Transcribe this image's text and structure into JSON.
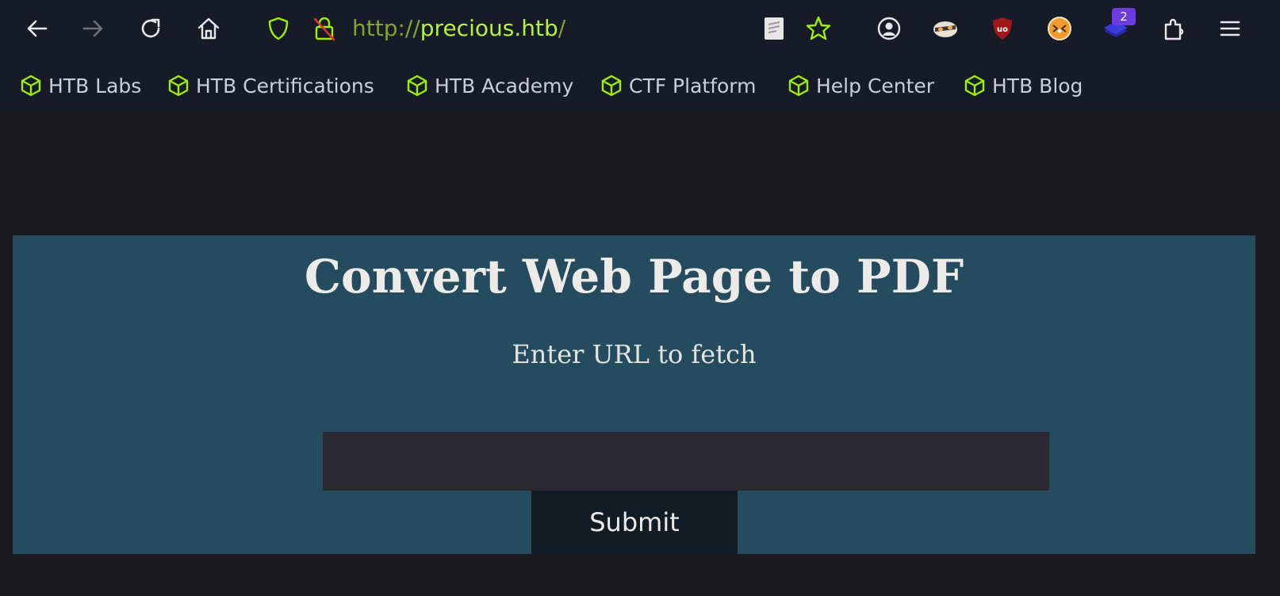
{
  "browser": {
    "url": {
      "scheme": "http://",
      "host": "precious.htb",
      "path": "/"
    },
    "extensions_badge": "2",
    "icons": {
      "back": "back-arrow-icon",
      "forward": "forward-arrow-icon",
      "reload": "reload-icon",
      "home": "home-icon",
      "tracking_protection": "shield-icon",
      "insecure_connection": "insecure-lock-icon",
      "reader_view": "reader-view-icon",
      "bookmark_star": "star-icon",
      "account": "account-icon",
      "extension_1": "extension-badger-icon",
      "extension_2": "ublock-origin-icon",
      "extension_3": "extension-fox-icon",
      "extension_4": "extension-stack-icon",
      "extensions_menu": "extensions-icon",
      "main_menu": "hamburger-menu-icon"
    },
    "bookmarks": [
      {
        "label": "HTB Labs",
        "icon": "cube-icon"
      },
      {
        "label": "HTB Certifications",
        "icon": "cube-icon"
      },
      {
        "label": "HTB Academy",
        "icon": "cube-icon"
      },
      {
        "label": "CTF Platform",
        "icon": "cube-icon"
      },
      {
        "label": "Help Center",
        "icon": "cube-icon"
      },
      {
        "label": "HTB Blog",
        "icon": "cube-icon"
      }
    ],
    "colors": {
      "toolbar_bg": "#161b27",
      "url_host": "#b3f340",
      "bookmark_icon": "#9fef00"
    }
  },
  "page": {
    "title": "Convert Web Page to PDF",
    "subtitle": "Enter URL to fetch",
    "url_input": {
      "value": "",
      "placeholder": ""
    },
    "submit_label": "Submit",
    "colors": {
      "panel_bg": "#254b5f",
      "input_bg": "#2b2a33",
      "button_bg": "#121c24"
    }
  }
}
